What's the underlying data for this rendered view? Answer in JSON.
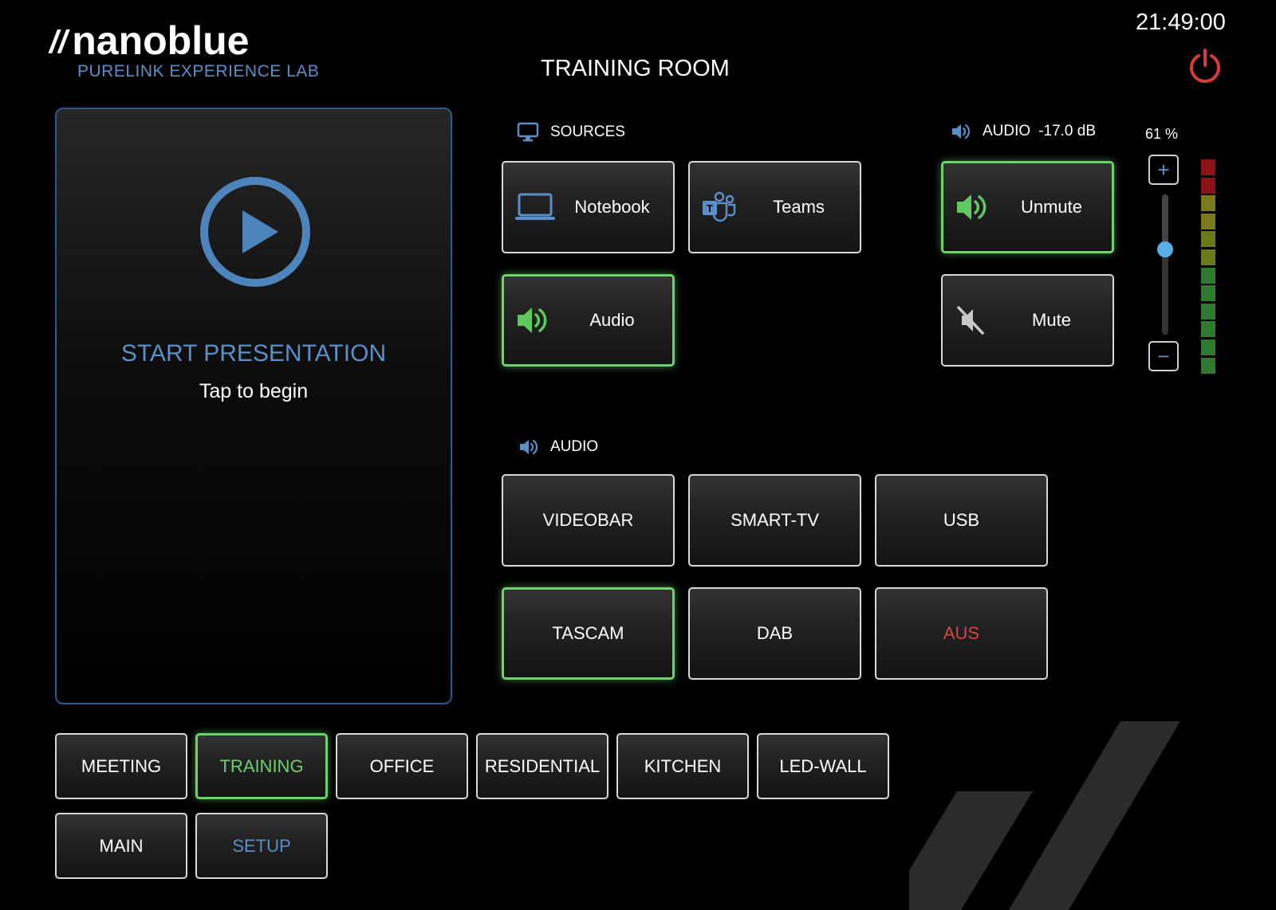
{
  "header": {
    "logo_slashes": "//",
    "logo_text": "nanoblue",
    "sub_title": "PURELINK EXPERIENCE LAB",
    "room_title": "TRAINING ROOM",
    "clock": "21:49:00",
    "power_icon": "power-icon",
    "power_color": "#d63b3b"
  },
  "presentation": {
    "title": "START PRESENTATION",
    "subtitle": "Tap to begin",
    "icon": "play-circle-icon"
  },
  "sources": {
    "heading": "SOURCES",
    "icon": "monitor-icon",
    "buttons": [
      {
        "label": "Notebook",
        "icon": "laptop-icon",
        "active": false
      },
      {
        "label": "Teams",
        "icon": "teams-icon",
        "active": false
      },
      {
        "label": "Audio",
        "icon": "speaker-icon",
        "active": true
      }
    ]
  },
  "audio_control": {
    "heading": "AUDIO",
    "level": "-17.0 dB",
    "volume_percent": "61 %",
    "volume_value": 0.61,
    "unmute_label": "Unmute",
    "mute_label": "Mute",
    "unmute_active": true,
    "plus": "+",
    "minus": "−"
  },
  "audio_sources": {
    "heading": "AUDIO",
    "buttons": [
      {
        "label": "VIDEOBAR",
        "active": false
      },
      {
        "label": "SMART-TV",
        "active": false
      },
      {
        "label": "USB",
        "active": false
      },
      {
        "label": "TASCAM",
        "active": true
      },
      {
        "label": "DAB",
        "active": false
      },
      {
        "label": "AUS",
        "active": false,
        "color": "#d64545"
      }
    ]
  },
  "tabs": {
    "row1": [
      "MEETING",
      "TRAINING",
      "OFFICE",
      "RESIDENTIAL",
      "KITCHEN",
      "LED-WALL"
    ],
    "row2": [
      "MAIN",
      "SETUP"
    ],
    "active": "TRAINING",
    "setup_color": "#5b8fc7"
  },
  "colors": {
    "accent_blue": "#5b8fc7",
    "active_green": "#6fd06f",
    "alert_red": "#d64545"
  }
}
